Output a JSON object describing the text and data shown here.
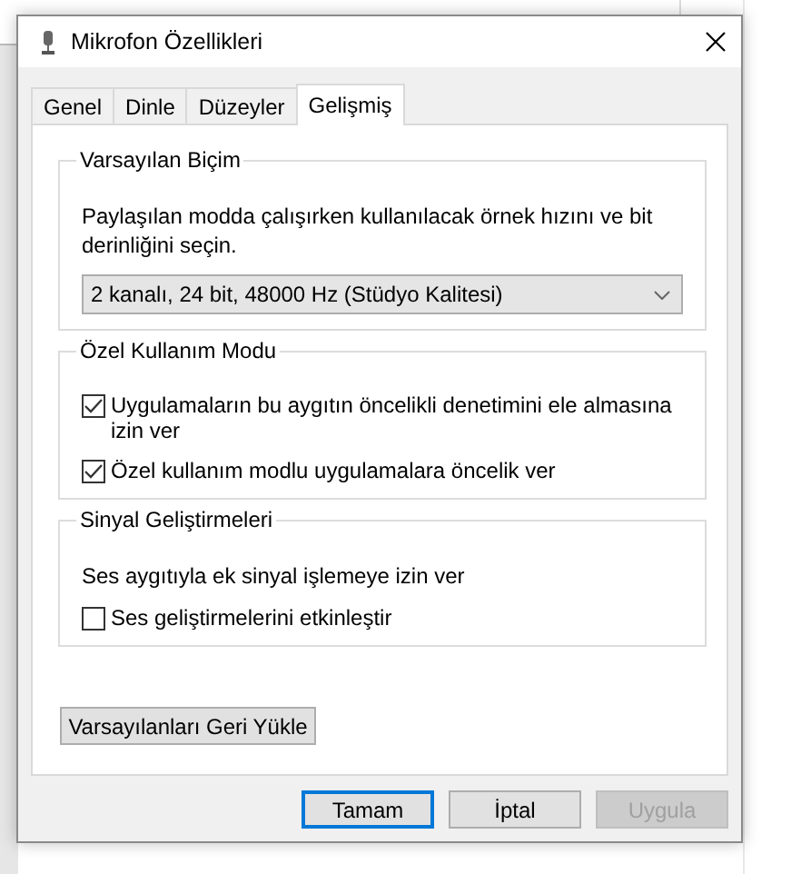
{
  "window": {
    "title": "Mikrofon Özellikleri"
  },
  "tabs": [
    {
      "label": "Genel",
      "selected": false
    },
    {
      "label": "Dinle",
      "selected": false
    },
    {
      "label": "Düzeyler",
      "selected": false
    },
    {
      "label": "Gelişmiş",
      "selected": true
    }
  ],
  "groups": [
    {
      "title": "Varsayılan Biçim",
      "items": [
        {
          "kind": "text",
          "text": "Paylaşılan modda çalışırken kullanılacak örnek hızını ve bit derinliğini seçin."
        },
        {
          "kind": "dropdown",
          "value": "2 kanalı, 24 bit, 48000 Hz (Stüdyo Kalitesi)"
        }
      ]
    },
    {
      "title": "Özel Kullanım Modu",
      "items": [
        {
          "kind": "checkbox",
          "label": "Uygulamaların bu aygıtın öncelikli denetimini ele almasına izin ver",
          "checked": true
        },
        {
          "kind": "checkbox",
          "label": "Özel kullanım modlu uygulamalara öncelik ver",
          "checked": true
        }
      ]
    },
    {
      "title": "Sinyal Geliştirmeleri",
      "items": [
        {
          "kind": "text",
          "text": "Ses aygıtıyla ek sinyal işlemeye izin ver"
        },
        {
          "kind": "checkbox",
          "label": "Ses geliştirmelerini etkinleştir",
          "checked": false
        }
      ]
    }
  ],
  "restore_button": "Varsayılanları Geri Yükle",
  "buttons": [
    {
      "label": "Tamam",
      "default": true,
      "disabled": false
    },
    {
      "label": "İptal",
      "default": false,
      "disabled": false
    },
    {
      "label": "Uygula",
      "default": false,
      "disabled": true
    }
  ]
}
